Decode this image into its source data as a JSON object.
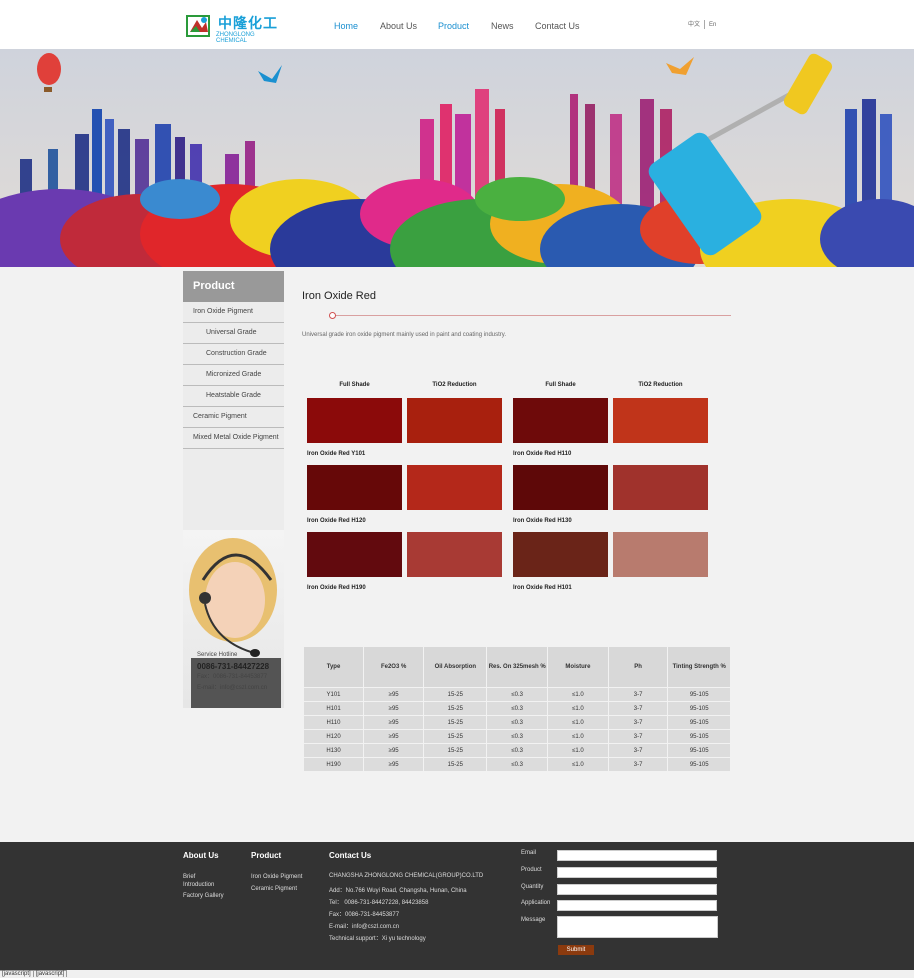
{
  "header": {
    "logo_cn": "中隆化工",
    "logo_en": "ZHONGLONG CHEMICAL",
    "nav": [
      {
        "label": "Home",
        "active": true
      },
      {
        "label": "About Us",
        "active": false
      },
      {
        "label": "Product",
        "active": true
      },
      {
        "label": "News",
        "active": false
      },
      {
        "label": "Contact Us",
        "active": false
      }
    ],
    "lang_cn": "中文",
    "lang_en": "En"
  },
  "sidebar": {
    "title": "Product",
    "items": [
      {
        "label": "Iron Oxide Pigment",
        "sub": false
      },
      {
        "label": "Universal Grade",
        "sub": true
      },
      {
        "label": "Construction Grade",
        "sub": true
      },
      {
        "label": "Micronized Grade",
        "sub": true
      },
      {
        "label": "Heatstable Grade",
        "sub": true
      },
      {
        "label": "Ceramic Pigment",
        "sub": false
      },
      {
        "label": "Mixed Metal Oxide Pigment",
        "sub": false
      }
    ],
    "service": {
      "hotline_label": "Service Hotline",
      "phone": "0086-731-84427228",
      "fax": "Fax：0086-731-84453877",
      "email": "E-mail：info@cszl.com.cn"
    }
  },
  "content": {
    "title": "Iron Oxide Red",
    "description": "Universal grade iron oxide pigment mainly used in paint and coating industry.",
    "col_heads": [
      "Full Shade",
      "TiO2 Reduction",
      "Full Shade",
      "TiO2 Reduction"
    ],
    "swatches": [
      {
        "name": "Iron Oxide Red Y101",
        "full": "#8b0a0a",
        "tio2": "#a8200e"
      },
      {
        "name": "Iron Oxide Red H110",
        "full": "#6e0a0a",
        "tio2": "#c0341a"
      },
      {
        "name": "Iron Oxide Red H120",
        "full": "#660808",
        "tio2": "#b4281a"
      },
      {
        "name": "Iron Oxide Red H130",
        "full": "#5e0808",
        "tio2": "#a0322c"
      },
      {
        "name": "Iron Oxide Red H190",
        "full": "#620a0e",
        "tio2": "#a83a34"
      },
      {
        "name": "Iron Oxide Red H101",
        "full": "#6a2418",
        "tio2": "#b87b6e"
      }
    ]
  },
  "table": {
    "headers": [
      "Type",
      "Fe2O3 %",
      "Oil Absorption",
      "Res. On 325mesh %",
      "Moisture",
      "Ph",
      "Tinting Strength %"
    ],
    "rows": [
      [
        "Y101",
        "≥95",
        "15-25",
        "≤0.3",
        "≤1.0",
        "3-7",
        "95-105"
      ],
      [
        "H101",
        "≥95",
        "15-25",
        "≤0.3",
        "≤1.0",
        "3-7",
        "95-105"
      ],
      [
        "H110",
        "≥95",
        "15-25",
        "≤0.3",
        "≤1.0",
        "3-7",
        "95-105"
      ],
      [
        "H120",
        "≥95",
        "15-25",
        "≤0.3",
        "≤1.0",
        "3-7",
        "95-105"
      ],
      [
        "H130",
        "≥95",
        "15-25",
        "≤0.3",
        "≤1.0",
        "3-7",
        "95-105"
      ],
      [
        "H190",
        "≥95",
        "15-25",
        "≤0.3",
        "≤1.0",
        "3-7",
        "95-105"
      ]
    ]
  },
  "footer": {
    "about_title": "About Us",
    "about_links": [
      "Brief Introduction",
      "Factory Gallery"
    ],
    "product_title": "Product",
    "product_links": [
      "Iron Oxide Pigment",
      "Ceramic Pigment"
    ],
    "contact_title": "Contact Us",
    "contact_lines": [
      "CHANGSHA ZHONGLONG CHEMICAL(GROUP)CO.LTD",
      "Add：No.766 Wuyi Road, Changsha, Hunan, China",
      "Tel： 0086-731-84427228, 84423858",
      "Fax：0086-731-84453877",
      "E-mail：info@cszl.com.cn",
      "Technical support：Xi yu technology"
    ],
    "form_labels": [
      "Email",
      "Product",
      "Quantity",
      "Application",
      "Message"
    ],
    "submit_label": "Submit"
  },
  "status_bar": [
    "[javascript]",
    "[javascript]"
  ]
}
